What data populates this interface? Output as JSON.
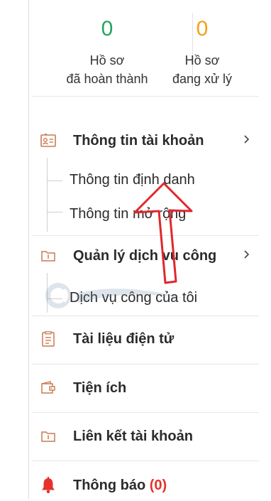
{
  "stats": [
    {
      "count": "0",
      "label_line1": "Hồ sơ",
      "label_line2": "đã hoàn thành",
      "color": "#22a55f"
    },
    {
      "count": "0",
      "label_line1": "Hồ sơ",
      "label_line2": "đang xử lý",
      "color": "#f2a219"
    }
  ],
  "menu": {
    "account_info": {
      "label": "Thông tin tài khoản",
      "icon": "id-card-icon"
    },
    "sub_identity": "Thông tin định danh",
    "sub_extended": "Thông tin mở rộng",
    "public_services": {
      "label": "Quản lý dịch vụ công",
      "icon": "folder-icon"
    },
    "sub_my_services": "Dịch vụ công của tôi",
    "documents": {
      "label": "Tài liệu điện tử",
      "icon": "document-icon"
    },
    "utilities": {
      "label": "Tiện ích",
      "icon": "wallet-icon"
    },
    "linked_accounts": {
      "label": "Liên kết tài khoản",
      "icon": "folder-link-icon"
    },
    "notifications": {
      "label": "Thông báo",
      "badge": "(0)",
      "icon": "bell-icon"
    }
  },
  "colors": {
    "icon": "#c97a50",
    "arrow": "#e0272e",
    "bell": "#e5322d"
  }
}
